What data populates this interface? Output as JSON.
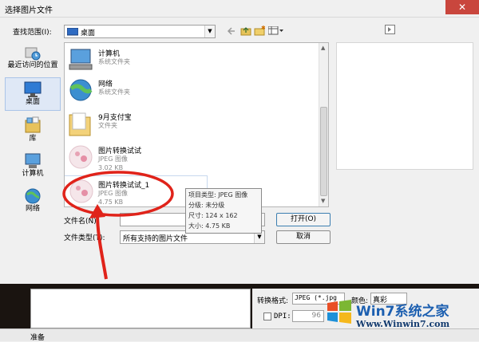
{
  "window": {
    "title": "选择图片文件",
    "close_symbol": "✕"
  },
  "lookin": {
    "label": "查找范围(I):",
    "value": "桌面"
  },
  "places": [
    {
      "label": "最近访问的位置",
      "icon": "recent-places-icon"
    },
    {
      "label": "桌面",
      "icon": "desktop-icon"
    },
    {
      "label": "库",
      "icon": "library-icon"
    },
    {
      "label": "计算机",
      "icon": "computer-icon"
    },
    {
      "label": "网络",
      "icon": "network-icon"
    }
  ],
  "files": [
    {
      "name": "计算机",
      "type": "系统文件夹",
      "size": "",
      "icon": "computer-icon"
    },
    {
      "name": "网络",
      "type": "系统文件夹",
      "size": "",
      "icon": "network-globe-icon"
    },
    {
      "name": "9月支付宝",
      "type": "文件夹",
      "size": "",
      "icon": "folder-icon"
    },
    {
      "name": "图片转换试试",
      "type": "JPEG 图像",
      "size": "3.02 KB",
      "icon": "jpeg-image-icon"
    },
    {
      "name": "图片转换试试_1",
      "type": "JPEG 图像",
      "size": "4.75 KB",
      "icon": "jpeg-image-icon"
    }
  ],
  "tooltip": {
    "line1": "项目类型: JPEG 图像",
    "line2": "分级: 未分级",
    "line3": "尺寸: 124 x 162",
    "line4": "大小: 4.75 KB"
  },
  "filename": {
    "label": "文件名(N):",
    "value": ""
  },
  "filetype": {
    "label": "文件类型(T):",
    "value": "所有支持的图片文件"
  },
  "buttons": {
    "open": "打开(O)",
    "cancel": "取消"
  },
  "bottom": {
    "convert_format_label": "转换格式:",
    "convert_format_value": "JPEG (*.jpg",
    "color_label": "颜色:",
    "color_value": "真彩",
    "dpi_label": "DPI:",
    "dpi_value": "96",
    "status": "准备"
  },
  "watermark": {
    "brand": "Win7系统之家",
    "url": "Www.Winwin7.com"
  },
  "colors": {
    "annotation_red": "#e0231a",
    "selection_blue": "#dfe8f6"
  }
}
